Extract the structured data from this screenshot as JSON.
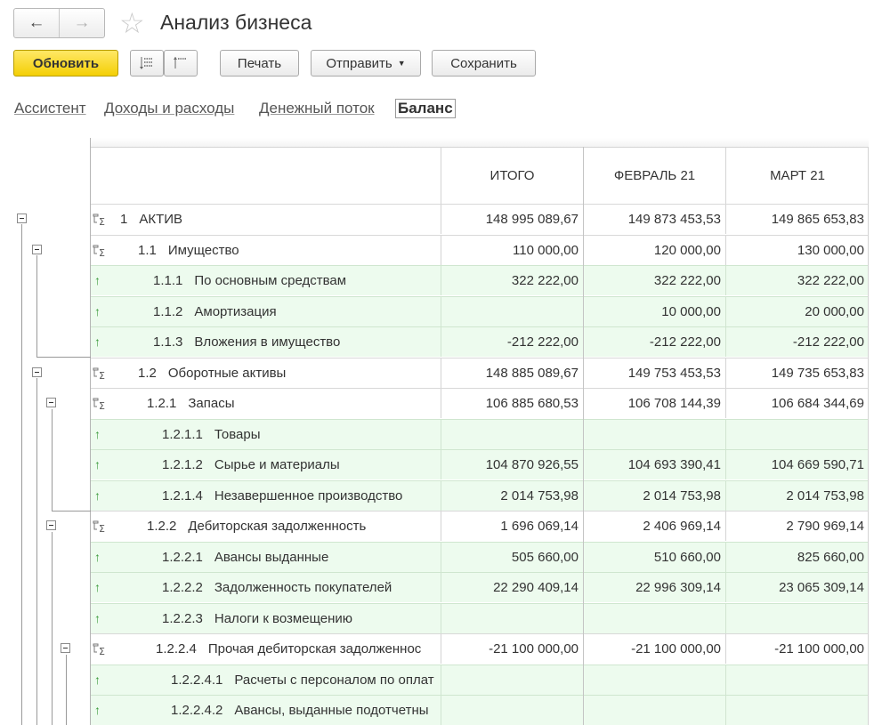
{
  "window": {
    "title": "Анализ бизнеса",
    "back_icon": "back-arrow-icon",
    "forward_icon": "forward-arrow-icon",
    "favorite_icon": "star-icon"
  },
  "toolbar": {
    "refresh_label": "Обновить",
    "print_label": "Печать",
    "send_label": "Отправить",
    "save_label": "Сохранить",
    "primary_color": "#f4cf05"
  },
  "tabs": [
    {
      "label": "Ассистент",
      "active": false
    },
    {
      "label": "Доходы и расходы",
      "active": false
    },
    {
      "label": "Денежный поток",
      "active": false
    },
    {
      "label": "Баланс",
      "active": true
    }
  ],
  "table": {
    "columns": [
      "ИТОГО",
      "ФЕВРАЛЬ 21",
      "МАРТ 21"
    ],
    "leaf_row_color": "#edfbee",
    "rows": [
      {
        "code": "1",
        "name": "АКТИВ",
        "type": "group",
        "level": 0,
        "values": [
          "148 995 089,67",
          "149 873 453,53",
          "149 865 653,83"
        ]
      },
      {
        "code": "1.1",
        "name": "Имущество",
        "type": "group",
        "level": 1,
        "values": [
          "110 000,00",
          "120 000,00",
          "130 000,00"
        ]
      },
      {
        "code": "1.1.1",
        "name": "По основным средствам",
        "type": "leaf",
        "level": 2,
        "values": [
          "322 222,00",
          "322 222,00",
          "322 222,00"
        ]
      },
      {
        "code": "1.1.2",
        "name": "Амортизация",
        "type": "leaf",
        "level": 2,
        "values": [
          "",
          "10 000,00",
          "20 000,00"
        ]
      },
      {
        "code": "1.1.3",
        "name": "Вложения в имущество",
        "type": "leaf",
        "level": 2,
        "values": [
          "-212 222,00",
          "-212 222,00",
          "-212 222,00"
        ]
      },
      {
        "code": "1.2",
        "name": "Оборотные активы",
        "type": "group",
        "level": 1,
        "values": [
          "148 885 089,67",
          "149 753 453,53",
          "149 735 653,83"
        ]
      },
      {
        "code": "1.2.1",
        "name": "Запасы",
        "type": "group",
        "level": 2,
        "values": [
          "106 885 680,53",
          "106 708 144,39",
          "106 684 344,69"
        ]
      },
      {
        "code": "1.2.1.1",
        "name": "Товары",
        "type": "leaf",
        "level": 3,
        "values": [
          "",
          "",
          ""
        ]
      },
      {
        "code": "1.2.1.2",
        "name": "Сырье и материалы",
        "type": "leaf",
        "level": 3,
        "values": [
          "104 870 926,55",
          "104 693 390,41",
          "104 669 590,71"
        ]
      },
      {
        "code": "1.2.1.4",
        "name": "Незавершенное производство",
        "type": "leaf",
        "level": 3,
        "values": [
          "2 014 753,98",
          "2 014 753,98",
          "2 014 753,98"
        ]
      },
      {
        "code": "1.2.2",
        "name": "Дебиторская задолженность",
        "type": "group",
        "level": 2,
        "values": [
          "1 696 069,14",
          "2 406 969,14",
          "2 790 969,14"
        ]
      },
      {
        "code": "1.2.2.1",
        "name": "Авансы выданные",
        "type": "leaf",
        "level": 3,
        "values": [
          "505 660,00",
          "510 660,00",
          "825 660,00"
        ]
      },
      {
        "code": "1.2.2.2",
        "name": "Задолженность покупателей",
        "type": "leaf",
        "level": 3,
        "values": [
          "22 290 409,14",
          "22 996 309,14",
          "23 065 309,14"
        ]
      },
      {
        "code": "1.2.2.3",
        "name": "Налоги к возмещению",
        "type": "leaf",
        "level": 3,
        "values": [
          "",
          "",
          ""
        ]
      },
      {
        "code": "1.2.2.4",
        "name": "Прочая дебиторская задолженнос",
        "type": "group",
        "level": 3,
        "values": [
          "-21 100 000,00",
          "-21 100 000,00",
          "-21 100 000,00"
        ]
      },
      {
        "code": "1.2.2.4.1",
        "name": "Расчеты с персоналом по оплат",
        "type": "leaf",
        "level": 4,
        "values": [
          "",
          "",
          ""
        ]
      },
      {
        "code": "1.2.2.4.2",
        "name": "Авансы, выданные подотчетны",
        "type": "leaf",
        "level": 4,
        "values": [
          "",
          "",
          ""
        ]
      }
    ]
  }
}
